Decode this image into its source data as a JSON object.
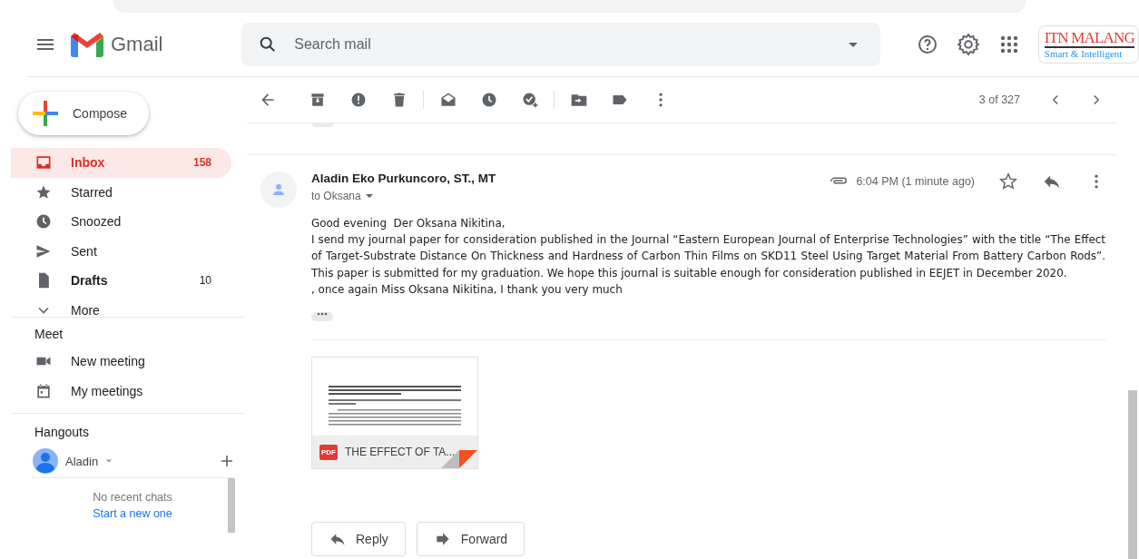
{
  "header": {
    "app_name": "Gmail",
    "search": {
      "placeholder": "Search mail"
    },
    "account_logo": {
      "title": "ITN MALANG",
      "tagline": "Smart & Intelligent"
    }
  },
  "compose": "Compose",
  "sidebar": {
    "items": [
      {
        "label": "Inbox",
        "count": "158",
        "selected": true,
        "unread": true
      },
      {
        "label": "Starred",
        "selected": false,
        "unread": false
      },
      {
        "label": "Snoozed",
        "selected": false,
        "unread": false
      },
      {
        "label": "Sent",
        "selected": false,
        "unread": false
      },
      {
        "label": "Drafts",
        "count": "10",
        "selected": false,
        "unread": true
      }
    ],
    "more": "More"
  },
  "meet": {
    "title": "Meet",
    "items": [
      "New meeting",
      "My meetings"
    ]
  },
  "hangouts": {
    "title": "Hangouts",
    "user": "Aladin",
    "empty": "No recent chats",
    "start_link": "Start a new one"
  },
  "toolbar": {
    "counter": "3 of 327"
  },
  "message": {
    "sender": "Aladin Eko Purkuncoro, ST., MT",
    "recipient": "to Oksana",
    "time": "6:04 PM (1 minute ago)",
    "starred": false,
    "body": [
      "Good evening  Der Oksana Nikitina,",
      "I send my journal paper for consideration published in the Journal “Eastern European Journal of Enterprise Technologies” with the title “The Effect of Target-Substrate Distance On Thickness and Hardness of Carbon Thin Films on SKD11 Steel Using Target Material From Battery Carbon Rods”. This paper is submitted for my graduation. We hope this journal is suitable enough for consideration published in EEJET in December 2020.",
      ", once again Miss Oksana Nikitina, I thank you very much"
    ],
    "attachment": {
      "type_badge": "PDF",
      "name": "THE EFFECT OF TA..."
    }
  },
  "actions": [
    "Reply",
    "Forward"
  ]
}
